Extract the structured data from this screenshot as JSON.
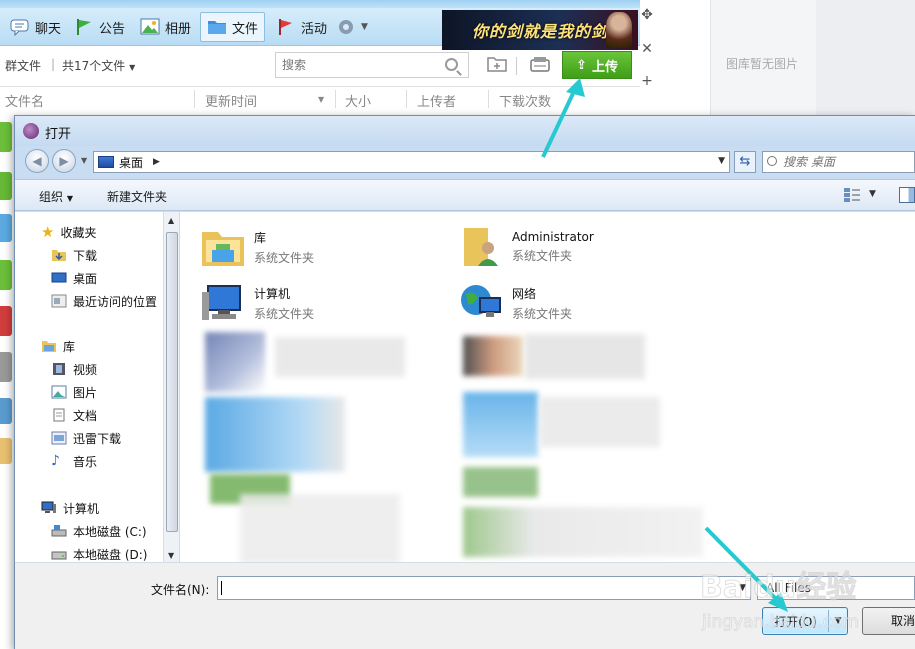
{
  "qq": {
    "tabs": [
      {
        "label": "聊天",
        "icon": "chat-bubble-icon"
      },
      {
        "label": "公告",
        "icon": "flag-icon"
      },
      {
        "label": "相册",
        "icon": "photo-icon"
      },
      {
        "label": "文件",
        "icon": "folder-icon",
        "active": true
      },
      {
        "label": "活动",
        "icon": "red-flag-icon"
      },
      {
        "label": "",
        "icon": "gear-icon"
      }
    ],
    "banner_text": "你的剑就是我的剑",
    "group_file_label": "群文件",
    "file_count": "共17个文件",
    "search_placeholder": "搜索",
    "upload_label": "上传",
    "columns": [
      "文件名",
      "更新时间",
      "大小",
      "上传者",
      "下载次数"
    ],
    "gallery_empty": "图库暂无图片"
  },
  "dialog": {
    "title": "打开",
    "location": "桌面",
    "search_placeholder": "搜索 桌面",
    "toolbar": {
      "organize": "组织",
      "new_folder": "新建文件夹"
    },
    "nav": {
      "favorites": "收藏夹",
      "favorites_items": [
        "下载",
        "桌面",
        "最近访问的位置"
      ],
      "libraries": "库",
      "library_items": [
        "视频",
        "图片",
        "文档",
        "迅雷下载",
        "音乐"
      ],
      "computer": "计算机",
      "computer_items": [
        "本地磁盘 (C:)",
        "本地磁盘 (D:)"
      ]
    },
    "items": [
      {
        "name": "库",
        "type": "系统文件夹",
        "icon": "library-folder-icon"
      },
      {
        "name": "Administrator",
        "type": "系统文件夹",
        "icon": "user-folder-icon"
      },
      {
        "name": "计算机",
        "type": "系统文件夹",
        "icon": "computer-icon"
      },
      {
        "name": "网络",
        "type": "系统文件夹",
        "icon": "network-globe-icon"
      }
    ],
    "filename_label": "文件名(N):",
    "filename_value": "",
    "filter_value": "All Files",
    "open_label": "打开(O)",
    "cancel_label": "取消"
  },
  "watermark": {
    "brand": "Baidu经验",
    "url": "jingyan.baidu.com"
  },
  "colors": {
    "upload_green": "#4caf22",
    "arrow_cyan": "#28c8d0",
    "dialog_chrome": "#c9ddf2"
  }
}
